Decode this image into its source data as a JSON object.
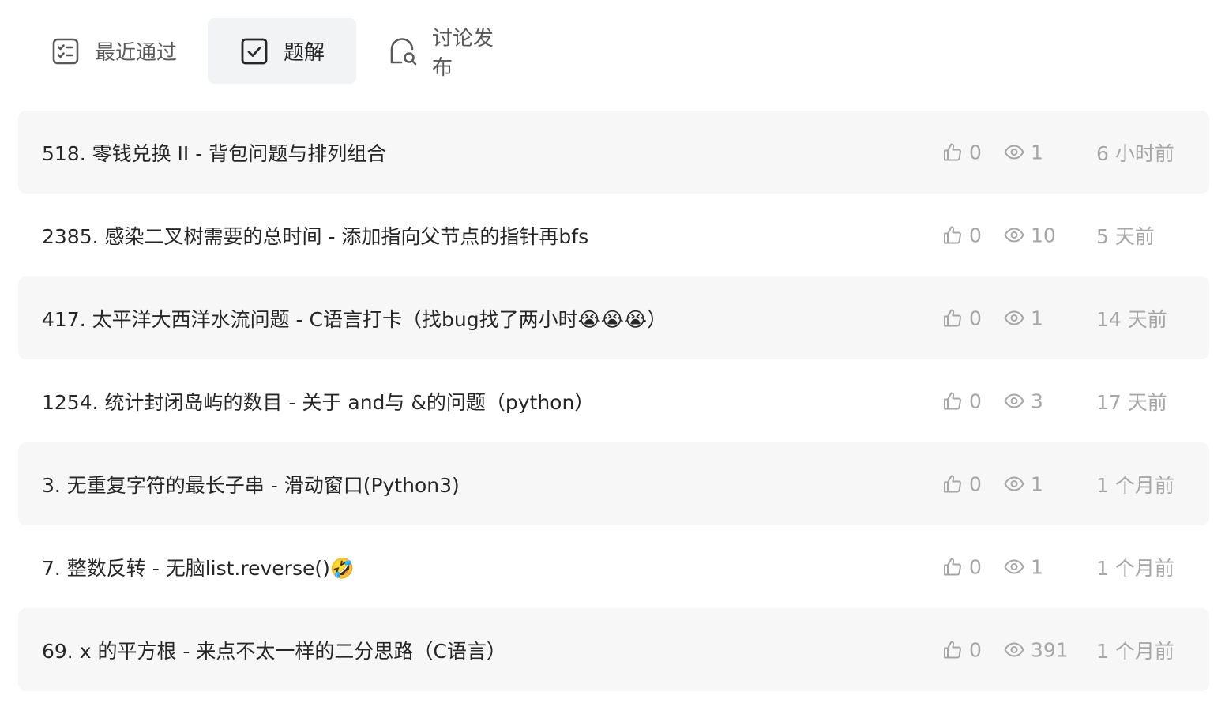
{
  "tabs": [
    {
      "label": "最近通过",
      "icon": "checklist-icon",
      "active": false
    },
    {
      "label": "题解",
      "icon": "checkbox-icon",
      "active": true
    },
    {
      "label": "讨论发布",
      "icon": "chat-search-icon",
      "active": false
    }
  ],
  "rows": [
    {
      "title": "518. 零钱兑换 II - 背包问题与排列组合",
      "likes": "0",
      "views": "1",
      "time": "6 小时前"
    },
    {
      "title": "2385. 感染二叉树需要的总时间 - 添加指向父节点的指针再bfs",
      "likes": "0",
      "views": "10",
      "time": "5 天前"
    },
    {
      "title": "417. 太平洋大西洋水流问题 - C语言打卡（找bug找了两小时😭😭😭）",
      "likes": "0",
      "views": "1",
      "time": "14 天前"
    },
    {
      "title": "1254. 统计封闭岛屿的数目 - 关于 and与 &的问题（python）",
      "likes": "0",
      "views": "3",
      "time": "17 天前"
    },
    {
      "title": "3. 无重复字符的最长子串 - 滑动窗口(Python3)",
      "likes": "0",
      "views": "1",
      "time": "1 个月前"
    },
    {
      "title": "7. 整数反转 - 无脑list.reverse()🤣",
      "likes": "0",
      "views": "1",
      "time": "1 个月前"
    },
    {
      "title": "69. x 的平方根 - 来点不太一样的二分思路（C语言）",
      "likes": "0",
      "views": "391",
      "time": "1 个月前"
    }
  ]
}
